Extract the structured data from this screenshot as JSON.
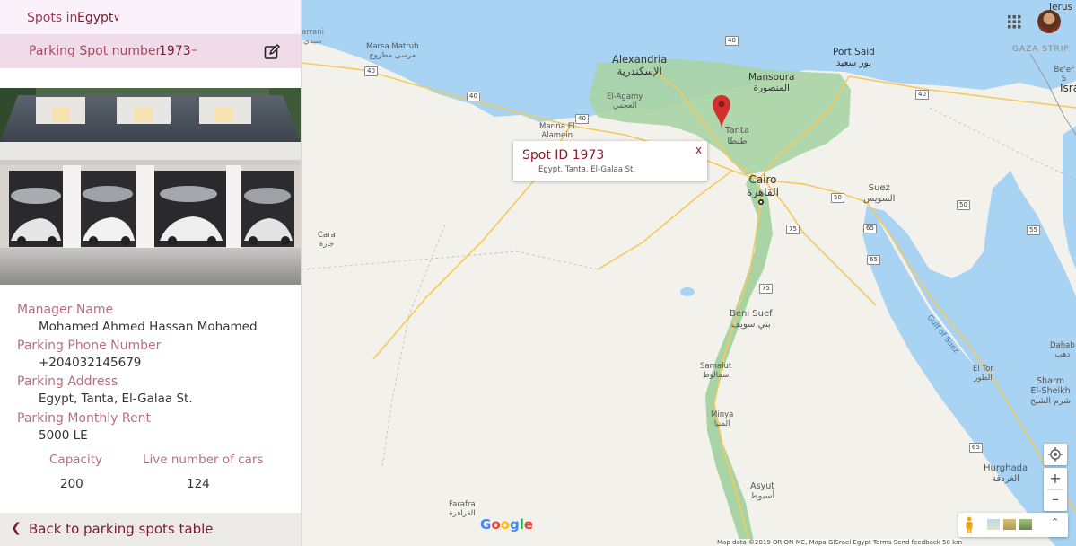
{
  "sidebar": {
    "spots_in_label": "Spots in",
    "country": "Egypt",
    "parking_spot_label": "Parking Spot number",
    "spot_number": "1973",
    "spot_dash": "–",
    "manager_label": "Manager Name",
    "manager_value": "Mohamed Ahmed Hassan Mohamed",
    "phone_label": "Parking Phone Number",
    "phone_value": "+204032145679",
    "address_label": "Parking Address",
    "address_value": "Egypt, Tanta, El-Galaa St.",
    "rent_label": "Parking Monthly Rent",
    "rent_value": "5000 LE",
    "capacity_label": "Capacity",
    "capacity_value": "200",
    "live_label": "Live number of cars",
    "live_value": "124",
    "back_label": "Back to parking spots table"
  },
  "map": {
    "popup_title": "Spot ID 1973",
    "popup_address": "Egypt, Tanta, El-Galaa St.",
    "popup_close": "x",
    "cities": {
      "alexandria": "Alexandria",
      "alexandria_ar": "الإسكندرية",
      "mansoura": "Mansoura",
      "mansoura_ar": "المنصورة",
      "port_said": "Port Said",
      "port_said_ar": "بور سعيد",
      "marsa_matruh": "Marsa Matruh",
      "marsa_matruh_ar": "مرسى مطروح",
      "el_agamy": "El-Agamy",
      "el_agamy_ar": "العجمي",
      "marina": "Marina El",
      "marina2": "Alamein",
      "tanta": "Tanta",
      "tanta_ar": "طنطا",
      "cairo": "Cairo",
      "cairo_ar": "القاهرة",
      "suez": "Suez",
      "suez_ar": "السويس",
      "cara": "Cara",
      "cara_ar": "جارة",
      "beni_suef": "Beni Suef",
      "beni_suef_ar": "بني سويف",
      "samalut": "Samalut",
      "samalut_ar": "سمالوط",
      "minya": "Minya",
      "minya_ar": "المنيا",
      "asyut": "Asyut",
      "asyut_ar": "أسيوط",
      "farafra": "Farafra",
      "farafra_ar": "الفرافرة",
      "hurghada": "Hurghada",
      "hurghada_ar": "الغردقة",
      "el_tor": "El Tor",
      "el_tor_ar": "الطور",
      "sharm": "Sharm",
      "sharm2": "El-Sheikh",
      "sharm_ar": "شرم الشيخ",
      "dahab": "Dahab",
      "dahab_ar": "دهب",
      "gulf_of_suez": "Gulf of Suez",
      "gaza_strip": "GAZA STRIP",
      "jerusalem": "Jerus",
      "beer_sheva": "Be'er S",
      "israel": "Isra",
      "arrani": "arrani",
      "arrani_ar": "سيدي"
    },
    "shields": [
      "40",
      "40",
      "40",
      "40",
      "40",
      "40",
      "50",
      "50",
      "55",
      "65",
      "65",
      "65",
      "75",
      "75"
    ],
    "google_logo": "Google",
    "attribution": "Map data ©2019 ORION-ME, Mapa GISrael   Egypt   Terms   Send feedback   50 km"
  }
}
